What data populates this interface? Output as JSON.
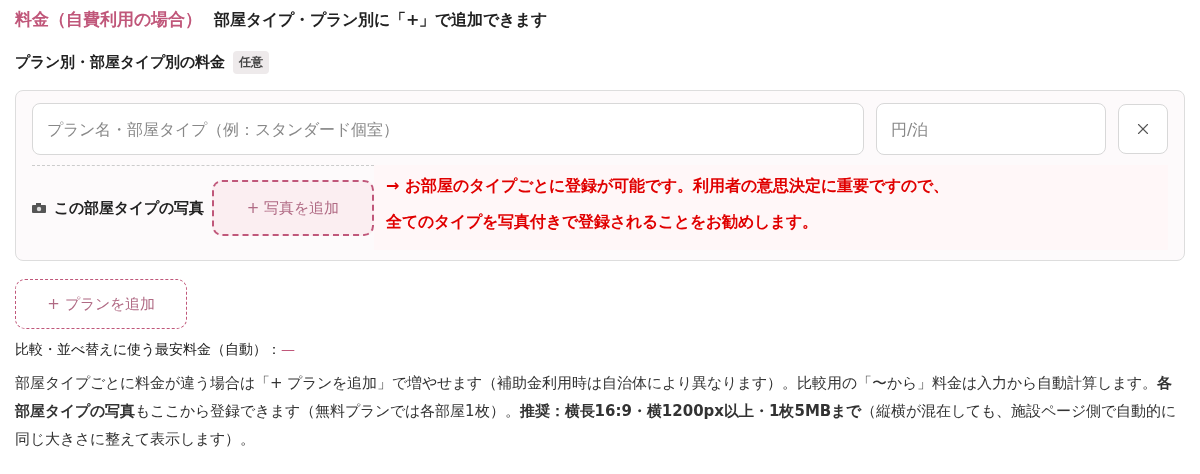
{
  "header": {
    "title": "料金（自費利用の場合）",
    "hint": "部屋タイプ・プラン別に「+」で追加できます"
  },
  "section": {
    "label": "プラン別・部屋タイプ別の料金",
    "badge": "任意"
  },
  "plan_card": {
    "name_placeholder": "プラン名・部屋タイプ（例：スタンダード個室）",
    "price_placeholder": "円/泊",
    "photo_label": "この部屋タイプの写真",
    "photo_button": "+ 写真を追加",
    "annotation": [
      "→ お部屋のタイプごとに登録が可能です。利用者の意思決定に重要ですので、",
      "全てのタイプを写真付きで登録されることをお勧めします。"
    ]
  },
  "add_plan_button": "+ プランを追加",
  "min_price": {
    "label": "比較・並べ替えに使う最安料金（自動）：",
    "value": "—"
  },
  "description": "部屋タイプごとに料金が違う場合は「+ プランを追加」で増やせます（補助金利用時は自治体により異なります）。比較用の「〜から」料金は入力から自動計算します。**各部屋タイプの写真**もここから登録できます（無料プランでは各部屋1枚）。**推奨：横長16:9・横1200px以上・1枚5MBまで**（縦横が混在しても、施設ページ側で自動的に同じ大きさに整えて表示します）。"
}
